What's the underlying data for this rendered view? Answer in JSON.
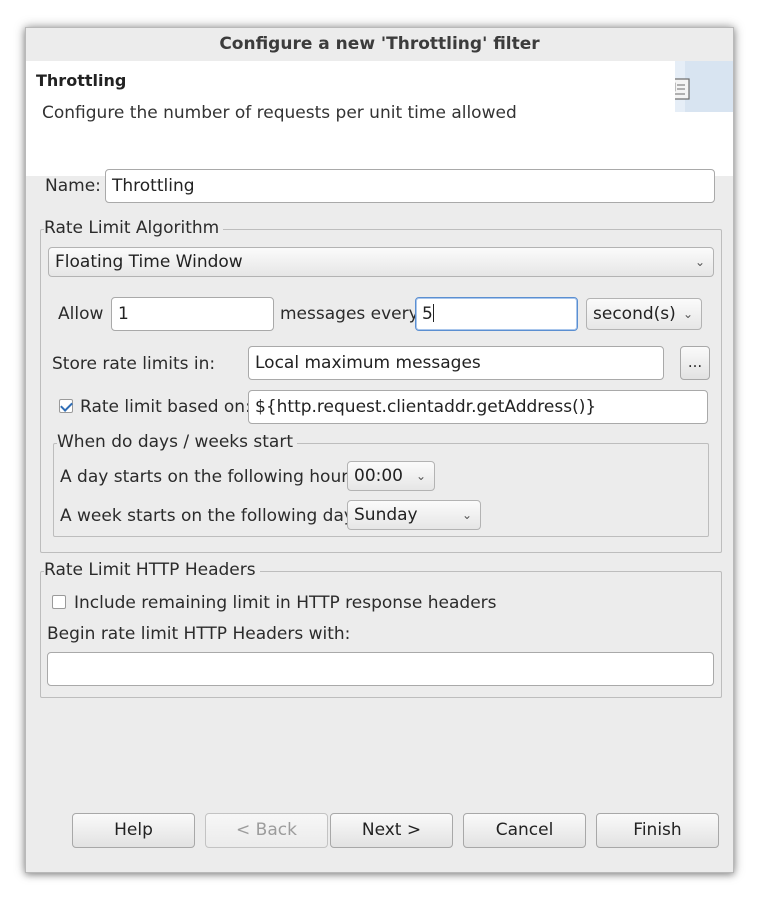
{
  "window": {
    "title": "Configure a new 'Throttling' filter"
  },
  "banner": {
    "title": "Throttling",
    "description": "Configure the number of requests per unit time allowed",
    "icon": "filter-config-icon"
  },
  "name": {
    "label": "Name:",
    "value": "Throttling"
  },
  "algorithm": {
    "legend": "Rate Limit Algorithm",
    "selected": "Floating Time Window",
    "allow_label": "Allow",
    "allow_value": "1",
    "messages_every_label": "messages every",
    "period_value": "5",
    "unit_selected": "second(s)",
    "store_label": "Store rate limits in:",
    "store_value": "Local maximum messages",
    "browse_label": "...",
    "based_on_label": "Rate limit based on:",
    "based_on_checked": true,
    "based_on_value": "${http.request.clientaddr.getAddress()}"
  },
  "start": {
    "legend": "When do days / weeks start",
    "day_label": "A day starts on the following hour:",
    "day_value": "00:00",
    "week_label": "A week starts on the following day:",
    "week_value": "Sunday"
  },
  "headers": {
    "legend": "Rate Limit HTTP Headers",
    "include_label": "Include remaining limit in HTTP response headers",
    "include_checked": false,
    "prefix_label": "Begin rate limit HTTP Headers with:",
    "prefix_value": ""
  },
  "buttons": {
    "help": "Help",
    "back": "< Back",
    "next": "Next >",
    "cancel": "Cancel",
    "finish": "Finish"
  },
  "colors": {
    "accent": "#2f6db5",
    "focus_border": "#5b8fd1",
    "dialog_bg": "#ececec"
  }
}
